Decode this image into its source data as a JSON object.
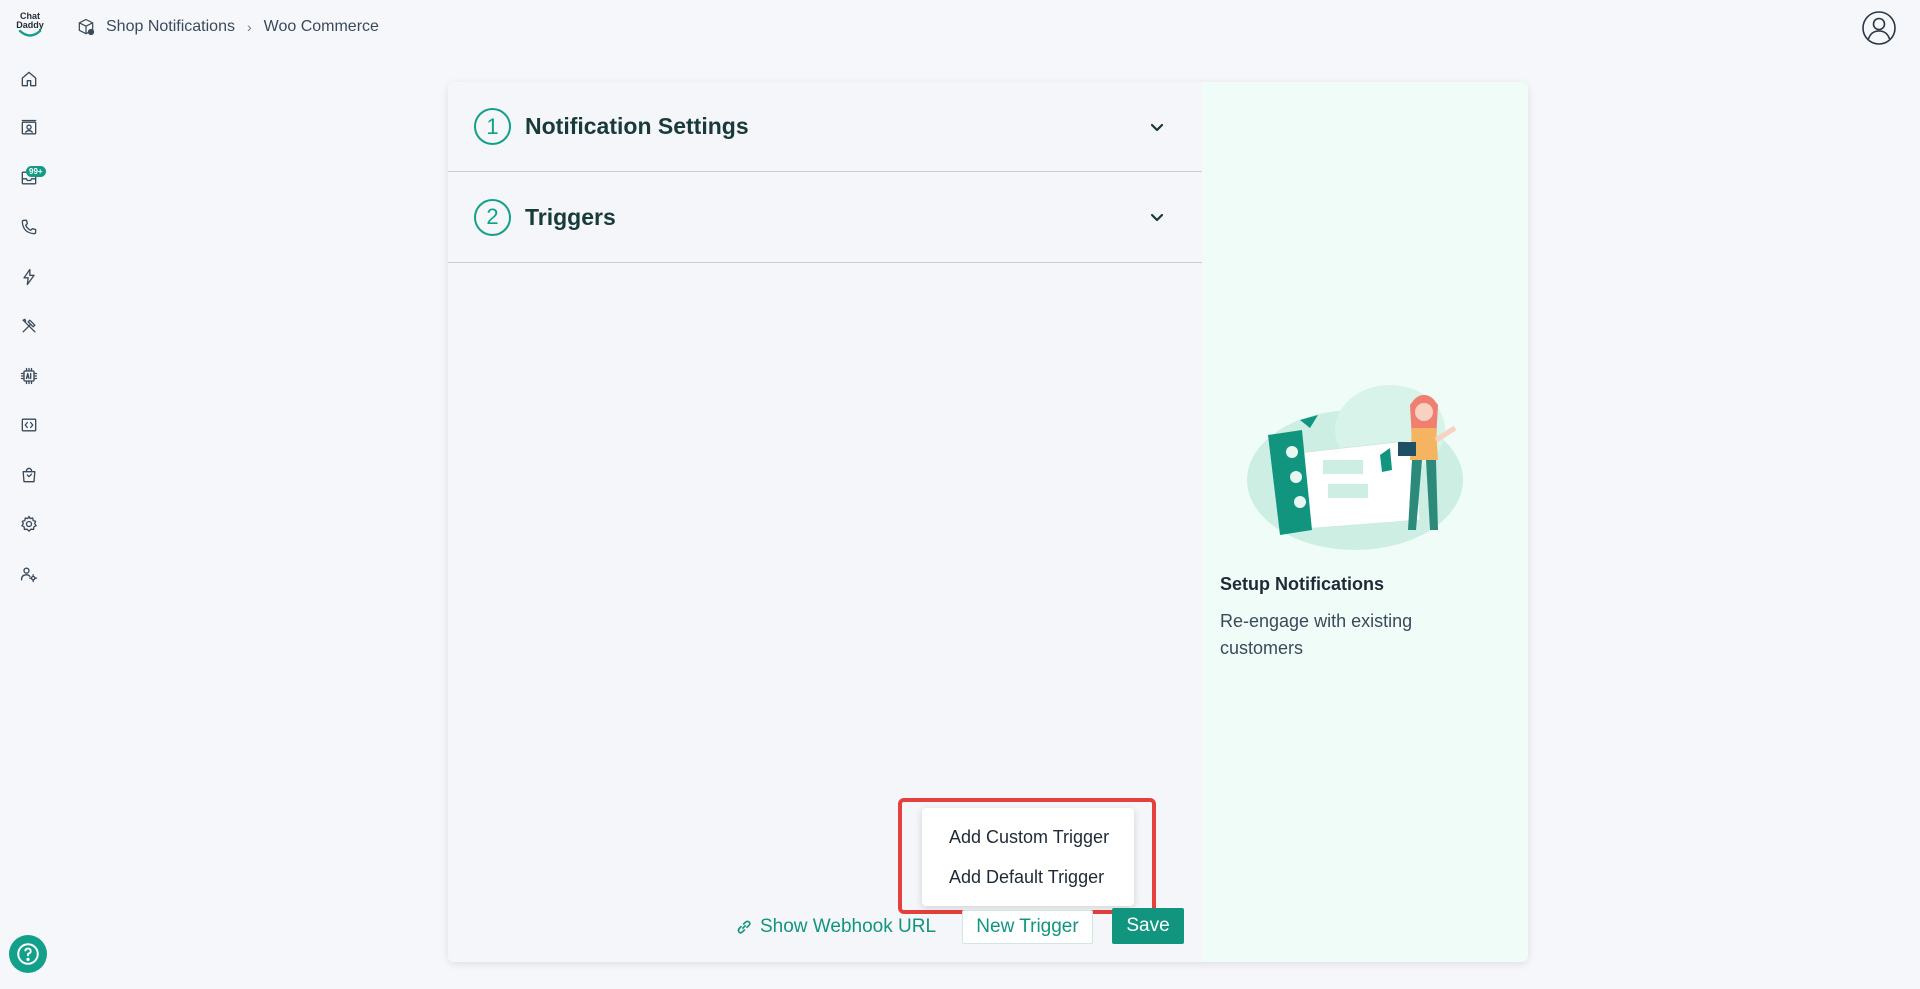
{
  "app": {
    "logo_line1": "Chat",
    "logo_line2": "Daddy"
  },
  "sidebar": {
    "items": [
      {
        "icon": "home-icon"
      },
      {
        "icon": "contacts-icon"
      },
      {
        "icon": "inbox-icon",
        "badge": "99+"
      },
      {
        "icon": "phone-icon"
      },
      {
        "icon": "lightning-icon"
      },
      {
        "icon": "tools-icon"
      },
      {
        "icon": "ai-chip-icon"
      },
      {
        "icon": "code-icon"
      },
      {
        "icon": "shop-bag-icon"
      },
      {
        "icon": "settings-gear-icon"
      },
      {
        "icon": "team-settings-icon"
      }
    ],
    "help_icon": "help-icon"
  },
  "breadcrumb": {
    "icon": "shop-notifications-icon",
    "items": [
      "Shop Notifications",
      "Woo Commerce"
    ]
  },
  "header": {
    "account_icon": "account-icon"
  },
  "sections": [
    {
      "number": "1",
      "title": "Notification Settings"
    },
    {
      "number": "2",
      "title": "Triggers"
    }
  ],
  "menu": {
    "items": [
      "Add Custom Trigger",
      "Add Default Trigger"
    ]
  },
  "actions": {
    "webhook_label": "Show Webhook URL",
    "new_trigger_label": "New Trigger",
    "save_label": "Save"
  },
  "side_panel": {
    "title": "Setup Notifications",
    "description": "Re-engage with existing customers"
  },
  "colors": {
    "accent": "#12957f",
    "highlight": "#e5403b",
    "side_panel_bg": "#effcf8"
  }
}
